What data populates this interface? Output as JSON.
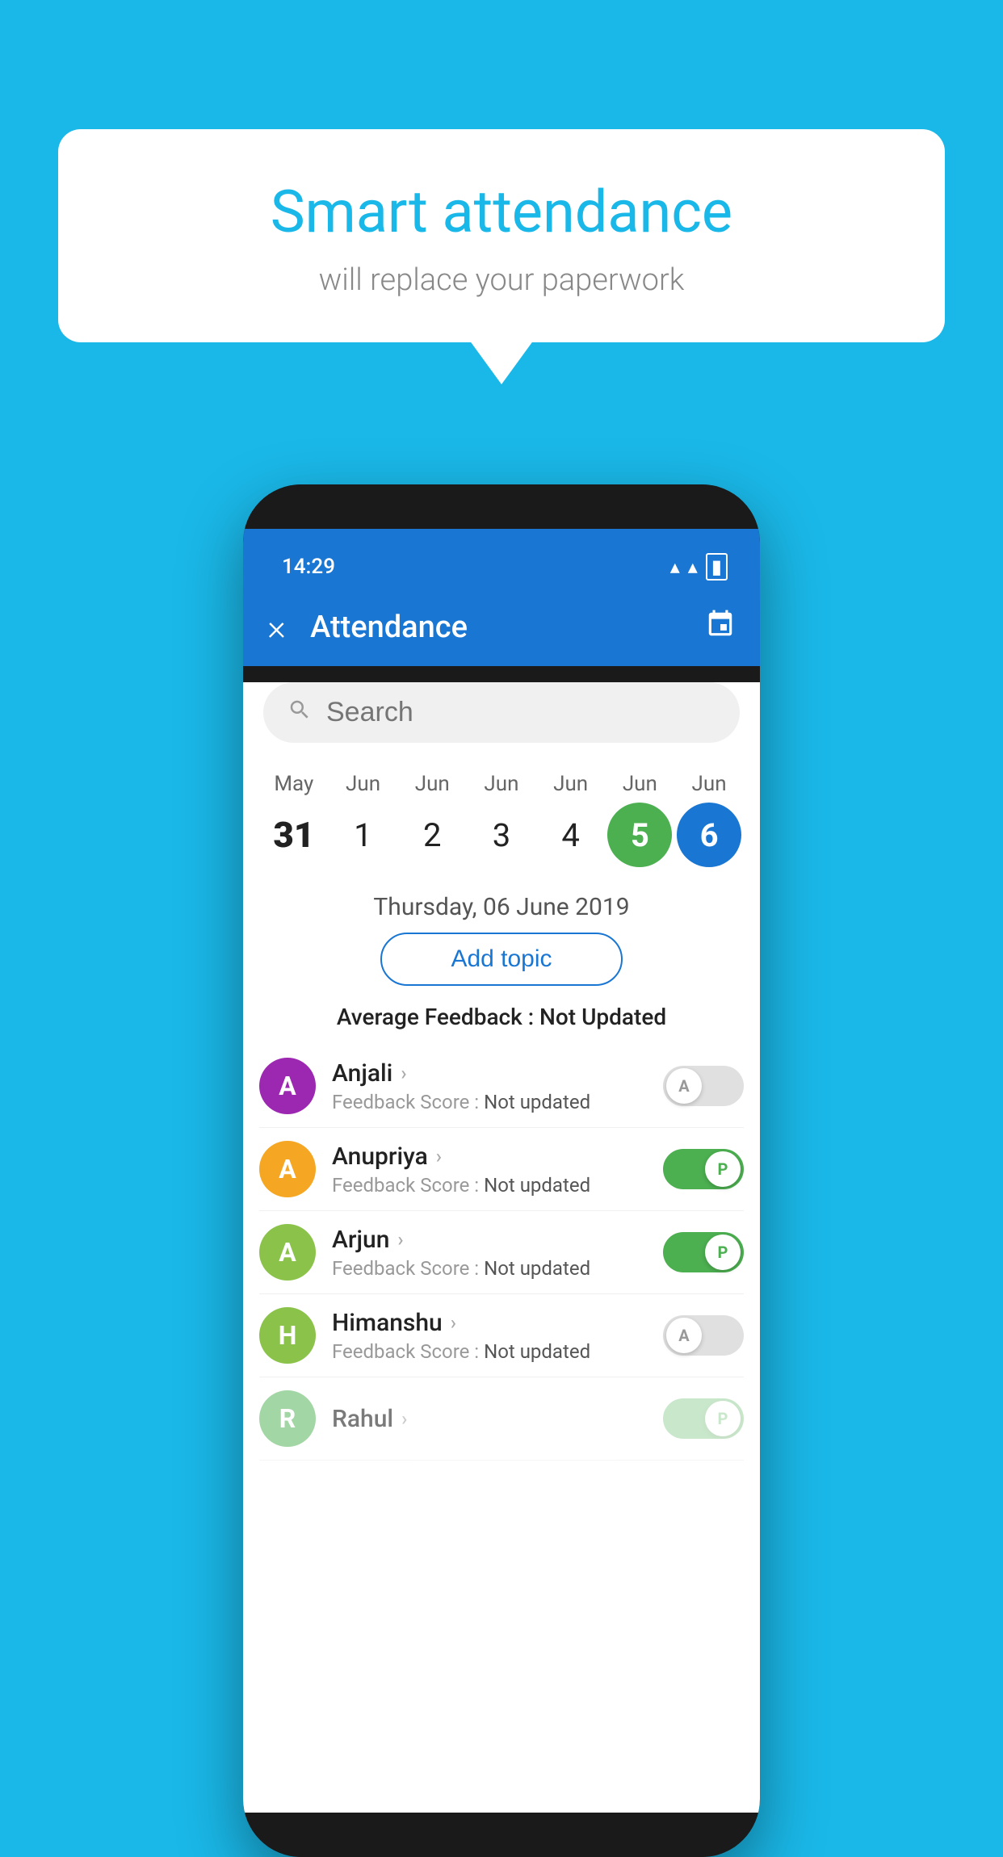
{
  "background_color": "#1ab8e8",
  "speech_bubble": {
    "title": "Smart attendance",
    "subtitle": "will replace your paperwork"
  },
  "phone": {
    "status_bar": {
      "time": "14:29"
    },
    "app_bar": {
      "title": "Attendance",
      "close_icon": "×",
      "calendar_icon": "📅"
    },
    "search": {
      "placeholder": "Search"
    },
    "calendar": {
      "months": [
        "May",
        "Jun",
        "Jun",
        "Jun",
        "Jun",
        "Jun",
        "Jun"
      ],
      "days": [
        {
          "day": "31",
          "state": "bold"
        },
        {
          "day": "1",
          "state": "normal"
        },
        {
          "day": "2",
          "state": "normal"
        },
        {
          "day": "3",
          "state": "normal"
        },
        {
          "day": "4",
          "state": "normal"
        },
        {
          "day": "5",
          "state": "today"
        },
        {
          "day": "6",
          "state": "selected"
        }
      ]
    },
    "selected_date": "Thursday, 06 June 2019",
    "add_topic_label": "Add topic",
    "avg_feedback_label": "Average Feedback :",
    "avg_feedback_value": "Not Updated",
    "students": [
      {
        "name": "Anjali",
        "avatar_letter": "A",
        "avatar_color": "#9c27b0",
        "feedback_label": "Feedback Score :",
        "feedback_value": "Not updated",
        "attendance": "A",
        "attendance_state": "off"
      },
      {
        "name": "Anupriya",
        "avatar_letter": "A",
        "avatar_color": "#f5a623",
        "feedback_label": "Feedback Score :",
        "feedback_value": "Not updated",
        "attendance": "P",
        "attendance_state": "on"
      },
      {
        "name": "Arjun",
        "avatar_letter": "A",
        "avatar_color": "#8bc34a",
        "feedback_label": "Feedback Score :",
        "feedback_value": "Not updated",
        "attendance": "P",
        "attendance_state": "on"
      },
      {
        "name": "Himanshu",
        "avatar_letter": "H",
        "avatar_color": "#8bc34a",
        "feedback_label": "Feedback Score :",
        "feedback_value": "Not updated",
        "attendance": "A",
        "attendance_state": "off"
      }
    ]
  }
}
